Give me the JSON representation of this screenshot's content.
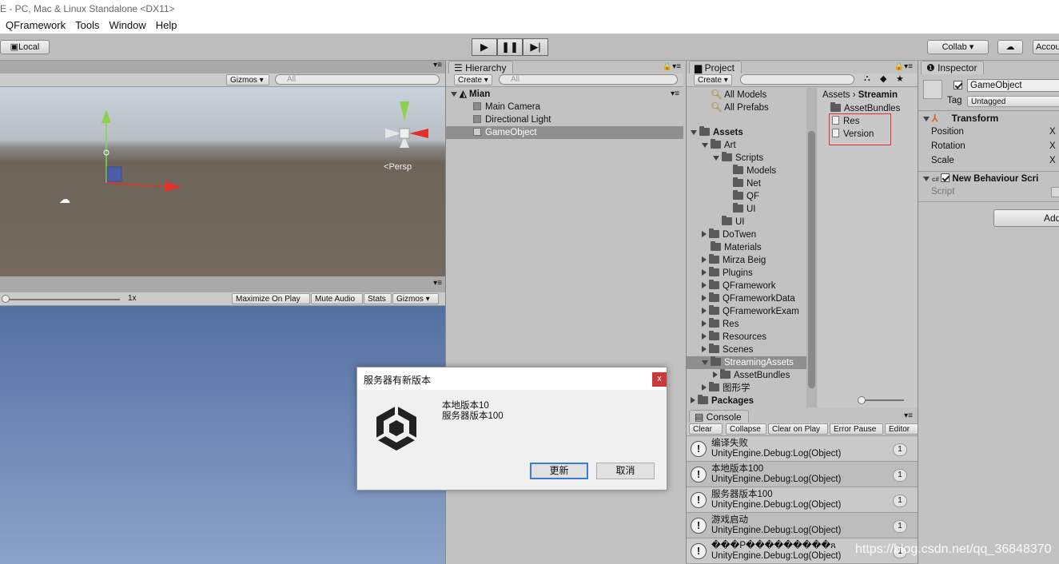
{
  "window": {
    "title": "E - PC, Mac & Linux Standalone <DX11>"
  },
  "menu": [
    "QFramework",
    "Tools",
    "Window",
    "Help"
  ],
  "toolbar": {
    "local": "Local",
    "collab": "Collab ▾",
    "account": "Accou"
  },
  "scene": {
    "gizmos": "Gizmos ▾",
    "search": "All",
    "persp": "Persp"
  },
  "game": {
    "scale": "1x",
    "maximize": "Maximize On Play",
    "mute": "Mute Audio",
    "stats": "Stats",
    "gizmos": "Gizmos"
  },
  "hierarchy": {
    "tab": "Hierarchy",
    "create": "Create ▾",
    "search": "All",
    "scene": "Mian",
    "items": [
      "Main Camera",
      "Directional Light",
      "GameObject"
    ]
  },
  "project": {
    "tab": "Project",
    "create": "Create ▾",
    "favorites": [
      "All Models",
      "All Prefabs"
    ],
    "tree": [
      "Assets",
      "Art",
      "Scripts",
      "Models",
      "Net",
      "QF",
      "UI",
      "UI",
      "DoTwen",
      "Materials",
      "Mirza Beig",
      "Plugins",
      "QFramework",
      "QFrameworkData",
      "QFrameworkExam",
      "Res",
      "Resources",
      "Scenes",
      "StreamingAssets",
      "AssetBundles",
      "图形学",
      "Packages"
    ],
    "breadcrumb": [
      "Assets",
      "Streamin"
    ],
    "files": [
      "AssetBundles",
      "Res",
      "Version"
    ]
  },
  "inspector": {
    "tab": "Inspector",
    "name": "GameObject",
    "tag_label": "Tag",
    "tag": "Untagged",
    "transform": "Transform",
    "position": "Position",
    "rotation": "Rotation",
    "scale": "Scale",
    "x": "X",
    "component": "New Behaviour Scri",
    "script": "Script",
    "add": "Add"
  },
  "console": {
    "tab": "Console",
    "buttons": [
      "Clear",
      "Collapse",
      "Clear on Play",
      "Error Pause",
      "Editor"
    ],
    "entries": [
      {
        "line1": "编译失败",
        "line2": "UnityEngine.Debug:Log(Object)",
        "count": "1"
      },
      {
        "line1": "本地版本100",
        "line2": "UnityEngine.Debug:Log(Object)",
        "count": "1"
      },
      {
        "line1": "服务器版本100",
        "line2": "UnityEngine.Debug:Log(Object)",
        "count": "1"
      },
      {
        "line1": "游戏启动",
        "line2": "UnityEngine.Debug:Log(Object)",
        "count": "1"
      },
      {
        "line1": "���P���������ጸ",
        "line2": "UnityEngine.Debug:Log(Object)",
        "count": "1"
      }
    ]
  },
  "dialog": {
    "title": "服务器有新版本",
    "close": "x",
    "line1": "本地版本10",
    "line2": "服务器版本100",
    "ok": "更新",
    "cancel": "取消"
  },
  "watermark": "https://blog.csdn.net/qq_36848370"
}
